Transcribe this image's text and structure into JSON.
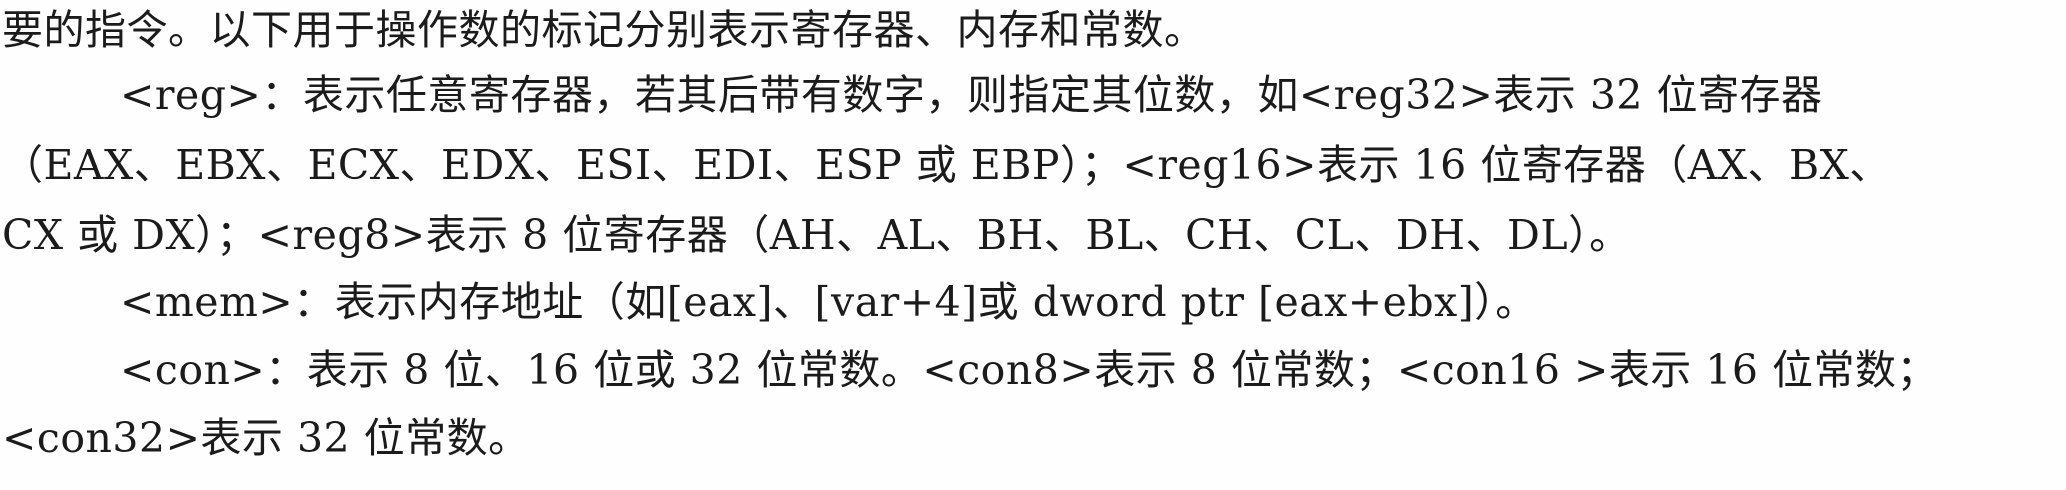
{
  "document": {
    "lines": [
      "要的指令。以下用于操作数的标记分别表示寄存器、内存和常数。",
      "<reg>：表示任意寄存器，若其后带有数字，则指定其位数，如<reg32>表示 32 位寄存器",
      "（EAX、EBX、ECX、EDX、ESI、EDI、ESP 或 EBP）；<reg16>表示 16 位寄存器（AX、BX、",
      "CX 或 DX）；<reg8>表示 8 位寄存器（AH、AL、BH、BL、CH、CL、DH、DL）。",
      "<mem>：表示内存地址（如[eax]、[var+4]或 dword ptr [eax+ebx]）。",
      "<con>：表示 8 位、16 位或 32 位常数。<con8>表示 8 位常数；<con16 >表示 16 位常数；",
      "<con32>表示 32 位常数。"
    ]
  }
}
